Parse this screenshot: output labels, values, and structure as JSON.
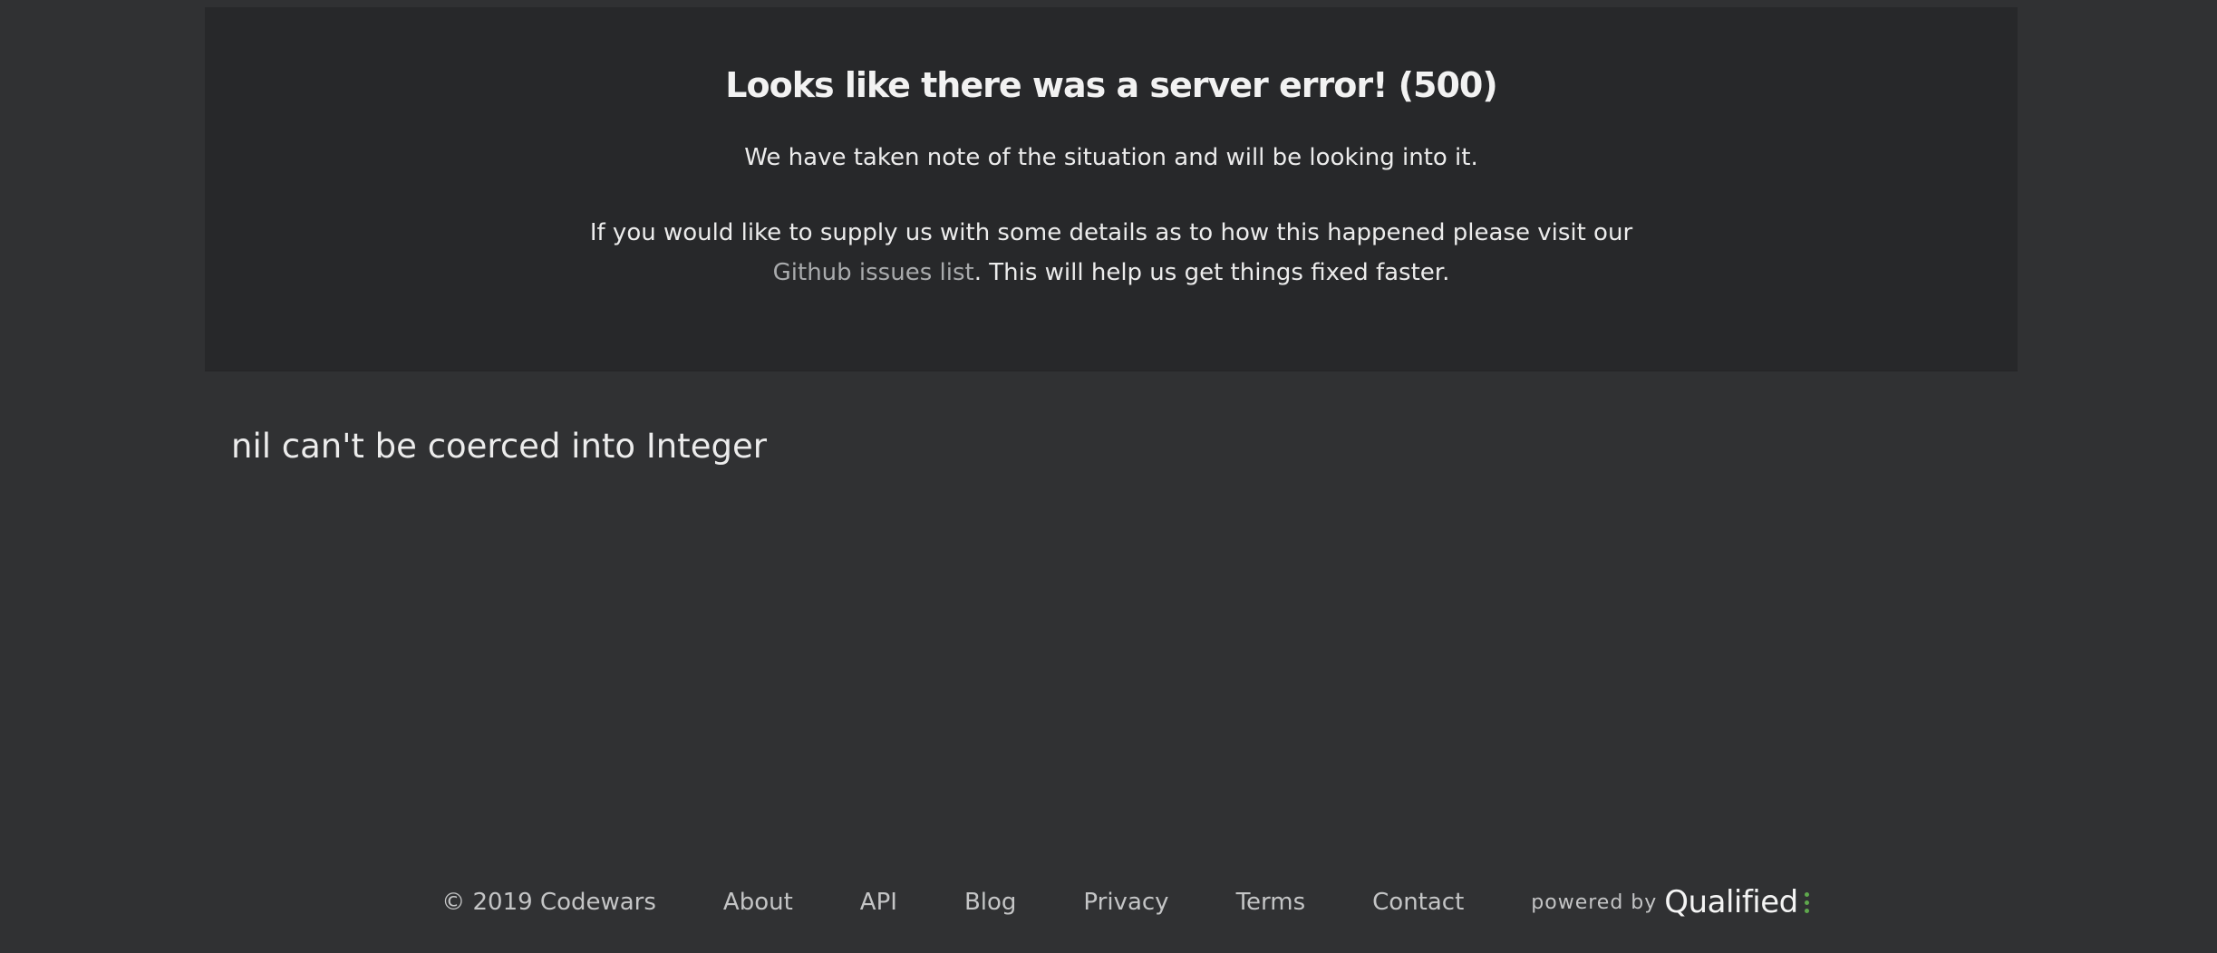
{
  "error_panel": {
    "title": "Looks like there was a server error! (500)",
    "note": "We have taken note of the situation and will be looking into it.",
    "details_before_link": "If you would like to supply us with some details as to how this happened please visit our ",
    "details_link_text": "Github issues list",
    "details_after_link": ". This will help us get things fixed faster."
  },
  "error_message": "nil can't be coerced into Integer",
  "footer": {
    "copyright": "© 2019 Codewars",
    "links": [
      "About",
      "API",
      "Blog",
      "Privacy",
      "Terms",
      "Contact"
    ],
    "powered_by_label": "powered by",
    "brand_name": "Qualified",
    "brand_icon": "qualified-dots-icon",
    "brand_accent_color": "#5fa84d"
  },
  "colors": {
    "background": "#303133",
    "panel": "#27282a",
    "link": "#a9abad"
  }
}
